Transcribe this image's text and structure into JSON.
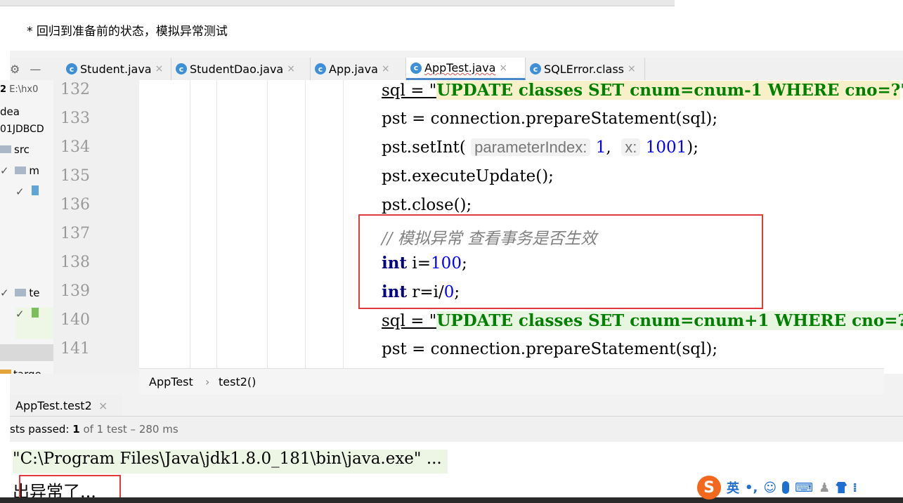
{
  "note": "* 回归到准备前的状态，模拟异常测试",
  "tabs": [
    {
      "label": "Student.java",
      "active": false
    },
    {
      "label": "StudentDao.java",
      "active": false
    },
    {
      "label": "App.java",
      "active": false
    },
    {
      "label": "AppTest.java",
      "active": true
    },
    {
      "label": "SQLError.class",
      "active": false
    }
  ],
  "sidebar": {
    "path": "E:\\hx0",
    "items": [
      "dea",
      "01JDBCD",
      "src",
      "m",
      "te",
      "targe"
    ],
    "project_num": "2"
  },
  "line_numbers": [
    "132",
    "133",
    "134",
    "135",
    "136",
    "137",
    "138",
    "139",
    "140",
    "141"
  ],
  "code": {
    "l132_a": "sql = \"",
    "l132_b": "UPDATE classes SET cnum=cnum-1 WHERE cno=?",
    "l132_c": "\";",
    "l133": "pst = connection.prepareStatement(sql);",
    "l134_a": "pst.setInt(",
    "l134_hint1": "parameterIndex:",
    "l134_v1": "1",
    "l134_sep": ",",
    "l134_hint2": "x:",
    "l134_v2": "1001",
    "l134_end": ");",
    "l135": "pst.executeUpdate();",
    "l136": "pst.close();",
    "l137": "// 模拟异常 查看事务是否生效",
    "l138_kw": "int",
    "l138_var": "i=",
    "l138_num": "100",
    "l138_end": ";",
    "l139_kw": "int",
    "l139_var": "r=i/",
    "l139_num": "0",
    "l139_end": ";",
    "l140_a": "sql = \"",
    "l140_b": "UPDATE classes SET cnum=cnum+1 WHERE cno=?",
    "l140_c": "\";",
    "l141": "pst = connection.prepareStatement(sql);"
  },
  "breadcrumb": {
    "class": "AppTest",
    "sep": "›",
    "method": "test2()"
  },
  "run": {
    "tab_label": "AppTest.test2",
    "status_prefix": "sts passed:",
    "passed_count": "1",
    "status_suffix": "of 1 test – 280 ms",
    "cmd": "\"C:\\Program Files\\Java\\jdk1.8.0_181\\bin\\java.exe\" ...",
    "output": "出异常了..."
  },
  "ime": {
    "logo": "S",
    "lang": "英",
    "punct": "•,",
    "emoji": "☺",
    "mic": "🎤",
    "kbd": "⌨",
    "user": "♟",
    "shirt": "👕",
    "grid": "⁞"
  },
  "colors": {
    "accent": "#4a88c7",
    "redbox": "#e03a3a",
    "keyword": "#000080",
    "string": "#008000",
    "number": "#0000ff",
    "sogou": "#f2681c"
  }
}
